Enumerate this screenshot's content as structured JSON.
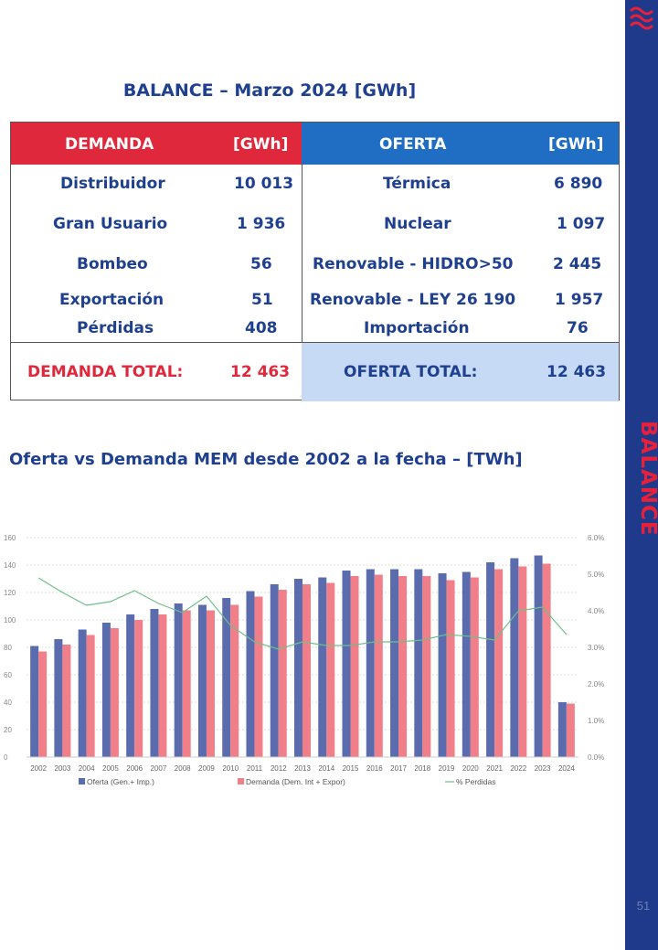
{
  "title": "BALANCE – Marzo 2024 [GWh]",
  "sidebar_title": "BALANCE",
  "page_number": "51",
  "colors": {
    "navy": "#1f3a8a",
    "red": "#e0283c",
    "blue": "#1f6ec4",
    "light_blue": "#c6daf5",
    "bar_oferta": "#5b6cae",
    "bar_demanda": "#f07f8a",
    "line_perdidas": "#6fbf8a"
  },
  "balance": {
    "demanda_header": "DEMANDA",
    "demanda_unit": "[GWh]",
    "oferta_header": "OFERTA",
    "oferta_unit": "[GWh]",
    "demanda_rows": [
      {
        "label": "Distribuidor",
        "value": "10 013"
      },
      {
        "label": "Gran Usuario",
        "value": "1 936"
      },
      {
        "label": "Bombeo",
        "value": "56"
      },
      {
        "label": "Exportación",
        "value": "51"
      },
      {
        "label": "Pérdidas",
        "value": "408"
      }
    ],
    "oferta_rows": [
      {
        "label": "Térmica",
        "value": "6 890"
      },
      {
        "label": "Nuclear",
        "value": "1 097"
      },
      {
        "label": "Renovable - HIDRO>50",
        "value": "2 445"
      },
      {
        "label": "Renovable - LEY 26 190",
        "value": "1 957"
      },
      {
        "label": "Importación",
        "value": "76"
      }
    ],
    "demanda_total_label": "DEMANDA TOTAL:",
    "demanda_total_value": "12 463",
    "oferta_total_label": "OFERTA TOTAL:",
    "oferta_total_value": "12 463"
  },
  "chart_title": "Oferta vs Demanda MEM desde 2002 a la fecha – [TWh]",
  "chart_data": {
    "type": "bar",
    "categories": [
      "2002",
      "2003",
      "2004",
      "2005",
      "2006",
      "2007",
      "2008",
      "2009",
      "2010",
      "2011",
      "2012",
      "2013",
      "2014",
      "2015",
      "2016",
      "2017",
      "2018",
      "2019",
      "2020",
      "2021",
      "2022",
      "2023",
      "2024"
    ],
    "series": [
      {
        "name": "Oferta (Gen.+ Imp.)",
        "type": "bar",
        "axis": "left",
        "values": [
          81,
          86,
          93,
          98,
          104,
          108,
          112,
          111,
          116,
          121,
          126,
          130,
          131,
          136,
          137,
          137,
          137,
          134,
          135,
          142,
          145,
          147,
          40
        ]
      },
      {
        "name": "Demanda (Dem. Int + Expor)",
        "type": "bar",
        "axis": "left",
        "values": [
          77,
          82,
          89,
          94,
          100,
          104,
          107,
          107,
          111,
          117,
          122,
          126,
          127,
          132,
          133,
          132,
          132,
          129,
          131,
          137,
          139,
          141,
          39
        ]
      },
      {
        "name": "% Perdidas",
        "type": "line",
        "axis": "right",
        "values": [
          4.9,
          4.5,
          4.15,
          4.25,
          4.55,
          4.2,
          3.95,
          4.4,
          3.6,
          3.15,
          2.95,
          3.15,
          3.05,
          3.05,
          3.15,
          3.15,
          3.2,
          3.35,
          3.3,
          3.2,
          4.0,
          4.1,
          3.35
        ]
      }
    ],
    "y_left": {
      "min": 0,
      "max": 160,
      "ticks": [
        "0",
        "20",
        "40",
        "60",
        "80",
        "100",
        "120",
        "140",
        "160"
      ]
    },
    "y_right": {
      "min": 0,
      "max": 6,
      "ticks": [
        "0.0%",
        "1.0%",
        "2.0%",
        "3.0%",
        "4.0%",
        "5.0%",
        "6.0%"
      ]
    },
    "grid": true,
    "legend_position": "bottom"
  }
}
